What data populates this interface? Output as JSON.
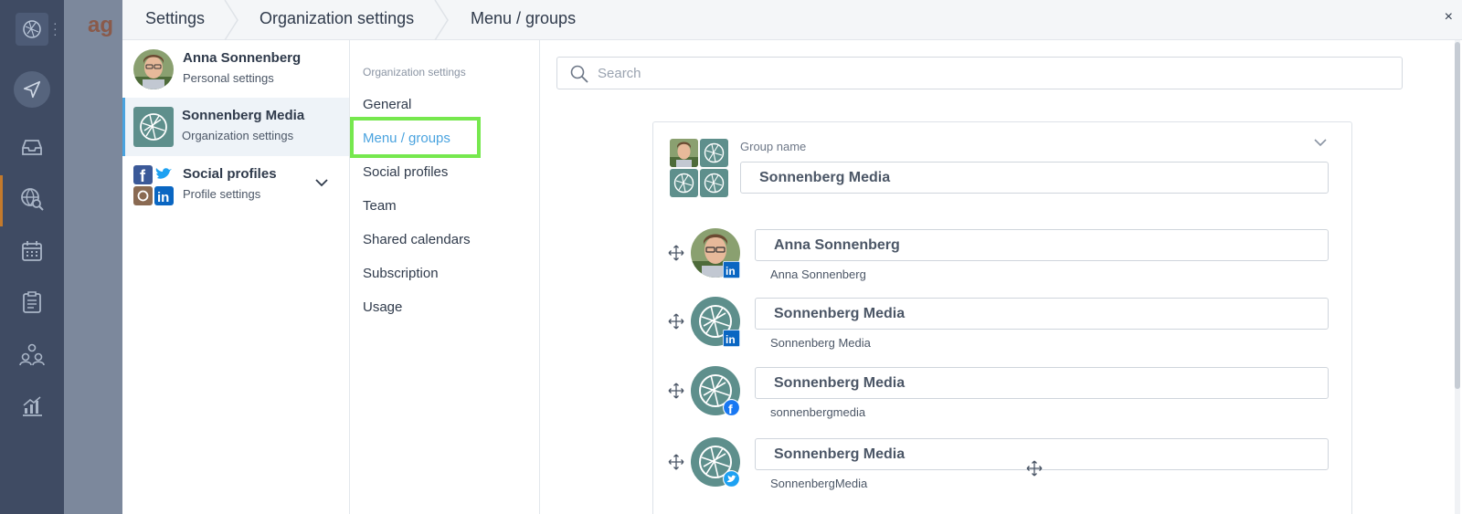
{
  "rail": {
    "icons": [
      "app-logo-icon",
      "more-icon",
      "send-icon",
      "inbox-icon",
      "globe-search-icon",
      "calendar-icon",
      "clipboard-icon",
      "team-icon",
      "analytics-icon"
    ]
  },
  "background_app": {
    "brand_fragment": "ag"
  },
  "breadcrumbs": [
    "Settings",
    "Organization settings",
    "Menu / groups"
  ],
  "close_label": "×",
  "accounts": [
    {
      "name": "Anna Sonnenberg",
      "subtitle": "Personal settings"
    },
    {
      "name": "Sonnenberg Media",
      "subtitle": "Organization settings"
    },
    {
      "name": "Social profiles",
      "subtitle": "Profile settings"
    }
  ],
  "org_menu": {
    "header": "Organization settings",
    "items": [
      "General",
      "Menu / groups",
      "Social profiles",
      "Team",
      "Shared calendars",
      "Subscription",
      "Usage"
    ],
    "selected": "Menu / groups"
  },
  "search": {
    "placeholder": "Search",
    "value": ""
  },
  "group": {
    "label": "Group name",
    "name": "Sonnenberg Media",
    "members": [
      {
        "display_name": "Anna Sonnenberg",
        "handle": "Anna Sonnenberg",
        "network": "linkedin"
      },
      {
        "display_name": "Sonnenberg Media",
        "handle": "Sonnenberg Media",
        "network": "linkedin"
      },
      {
        "display_name": "Sonnenberg Media",
        "handle": "sonnenbergmedia",
        "network": "facebook"
      },
      {
        "display_name": "Sonnenberg Media",
        "handle": "SonnenbergMedia",
        "network": "twitter"
      }
    ]
  },
  "colors": {
    "accent_blue": "#4aa3df",
    "highlight_green": "#76e84e",
    "org_teal": "#5e8f8c",
    "linkedin": "#0a66c2",
    "facebook": "#1877f2",
    "twitter": "#1da1f2",
    "rail": "#3f4b63"
  }
}
